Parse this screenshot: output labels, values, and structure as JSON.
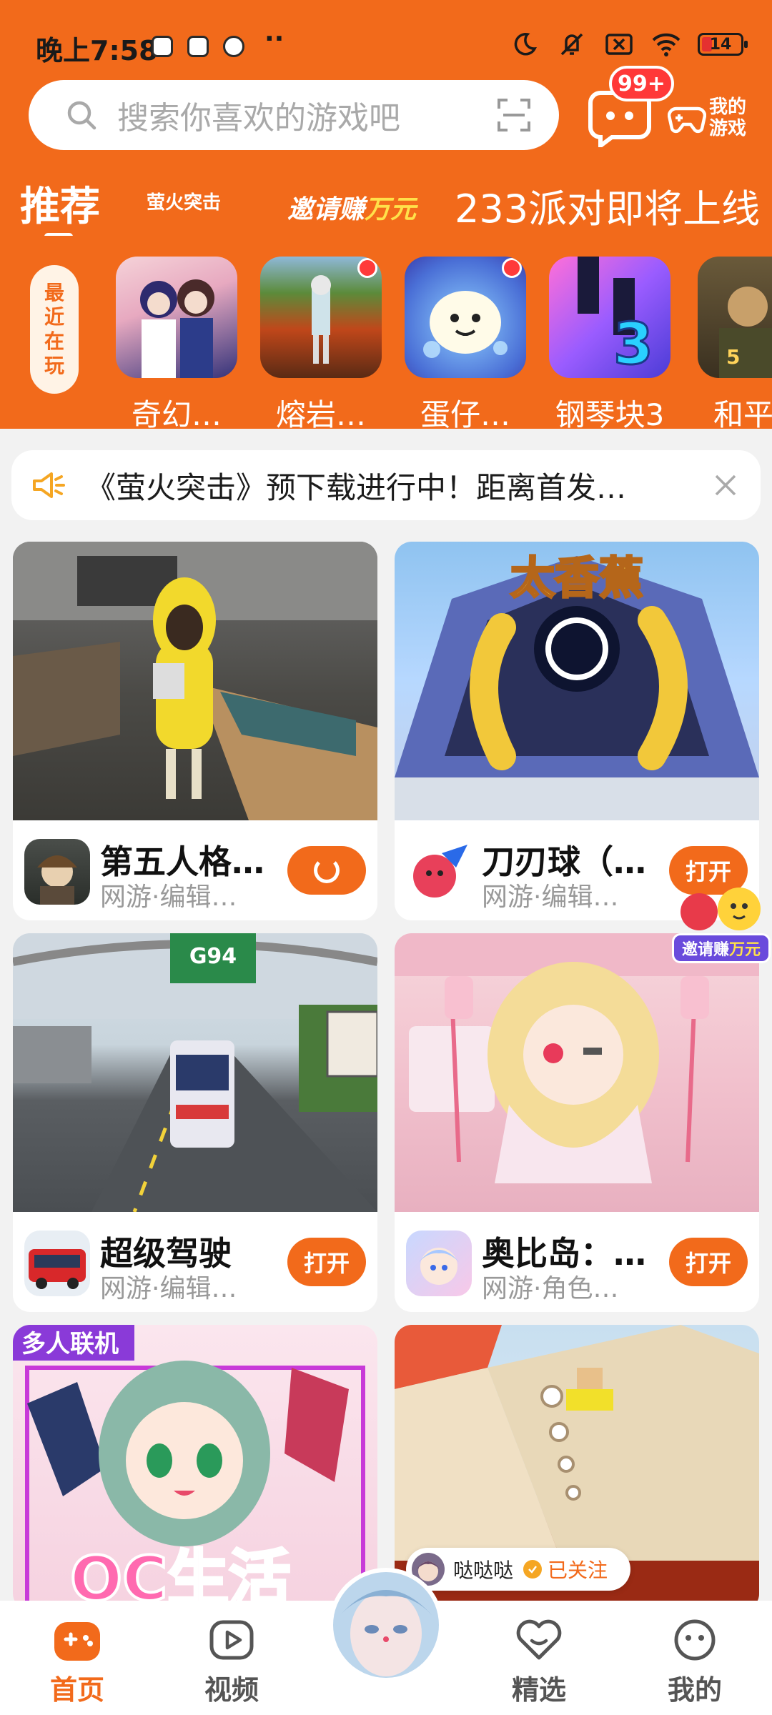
{
  "status_bar": {
    "time": "晚上7:58",
    "more": "··",
    "battery": "14"
  },
  "search": {
    "placeholder": "搜索你喜欢的游戏吧"
  },
  "header": {
    "message_badge": "99+",
    "my_games_label": "我的游戏"
  },
  "top_tabs": {
    "recommend": "推荐",
    "firefly": "萤火突击",
    "invite_prefix": "邀请赚",
    "invite_highlight": "万元",
    "party": "233派对即将上线"
  },
  "recent": {
    "label": "最近在玩",
    "games": [
      {
        "name": "奇幻…",
        "has_dot": false
      },
      {
        "name": "熔岩…",
        "has_dot": true
      },
      {
        "name": "蛋仔…",
        "has_dot": true
      },
      {
        "name": "钢琴块3",
        "has_dot": false
      },
      {
        "name": "和平…",
        "has_dot": false
      }
    ]
  },
  "notice": {
    "text": "《萤火突击》预下载进行中！距离首发…"
  },
  "cards": [
    {
      "title": "第五人格…",
      "subtitle": "网游·编辑…",
      "button": ""
    },
    {
      "title": "刀刃球（…",
      "subtitle": "网游·编辑…",
      "button": "打开"
    },
    {
      "title": "超级驾驶",
      "subtitle": "网游·编辑…",
      "button": "打开"
    },
    {
      "title": "奥比岛：…",
      "subtitle": "网游·角色…",
      "button": "打开"
    }
  ],
  "card_badges": {
    "multiplayer": "多人联机",
    "oc_life": "OC生活",
    "banana_title": "太香蕉",
    "road_sign": "G94"
  },
  "floating_invite": {
    "prefix": "邀请赚",
    "highlight": "万元"
  },
  "follow": {
    "name": "哒哒哒",
    "status": "已关注"
  },
  "bottom_nav": {
    "home": "首页",
    "video": "视频",
    "featured": "精选",
    "mine": "我的"
  },
  "colors": {
    "brand_orange": "#f26a1b",
    "badge_red": "#ff3838"
  }
}
